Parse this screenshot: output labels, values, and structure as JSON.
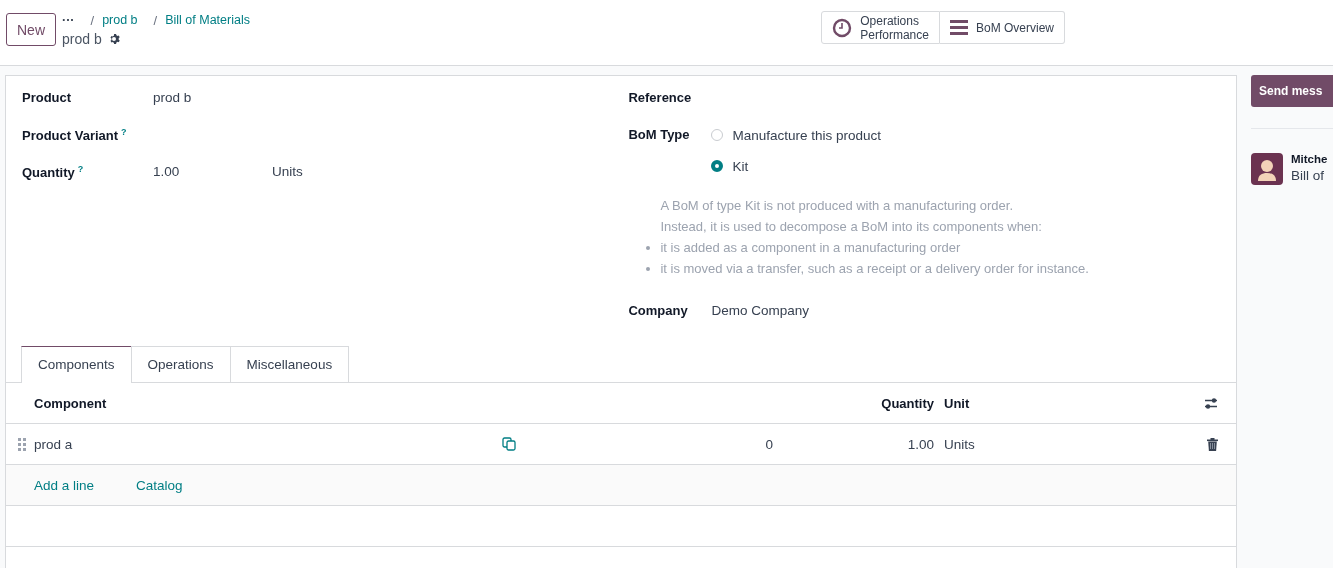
{
  "control_panel": {
    "new_button": "New",
    "breadcrumbs": [
      {
        "label": "···",
        "kind": "more"
      },
      {
        "label": "prod b",
        "kind": "link",
        "separator": "/"
      },
      {
        "label": "Bill of Materials",
        "kind": "link",
        "separator": "/"
      }
    ],
    "title": "prod b",
    "actions": [
      {
        "label": "Operations\nPerformance",
        "kind": "clock"
      },
      {
        "label": "BoM Overview",
        "kind": "bars"
      }
    ]
  },
  "form": {
    "left": [
      {
        "label": "Product",
        "value": "prod b"
      },
      {
        "label": "Product Variant",
        "help": "?"
      },
      {
        "label": "Quantity",
        "help": "?",
        "value": "1.00",
        "unit": "Units"
      }
    ],
    "reference_label": "Reference",
    "bom_type_label": "BoM Type",
    "bom_types": [
      {
        "label": "Manufacture this product",
        "selected": false
      },
      {
        "label": "Kit",
        "selected": true
      }
    ],
    "help_lines": [
      "A BoM of type Kit is not produced with a manufacturing order.",
      "Instead, it is used to decompose a BoM into its components when:"
    ],
    "help_bullets": [
      "it is added as a component in a manufacturing order",
      "it is moved via a transfer, such as a receipt or a delivery order for instance."
    ],
    "company_label": "Company",
    "company": "Demo Company"
  },
  "tabs": [
    {
      "label": "Components",
      "selected": true
    },
    {
      "label": "Operations",
      "selected": false
    },
    {
      "label": "Miscellaneous",
      "selected": false
    }
  ],
  "table": {
    "columns": [
      "Component",
      "Quantity",
      "Unit"
    ],
    "rows": [
      {
        "component": "prod a",
        "column_3": "0",
        "quantity": "1.00",
        "unit": "Units"
      }
    ],
    "add_links": [
      "Add a line",
      "Catalog"
    ]
  },
  "chatter": {
    "send_button": "Send mess",
    "author": "Mitche",
    "message": "Bill of"
  }
}
